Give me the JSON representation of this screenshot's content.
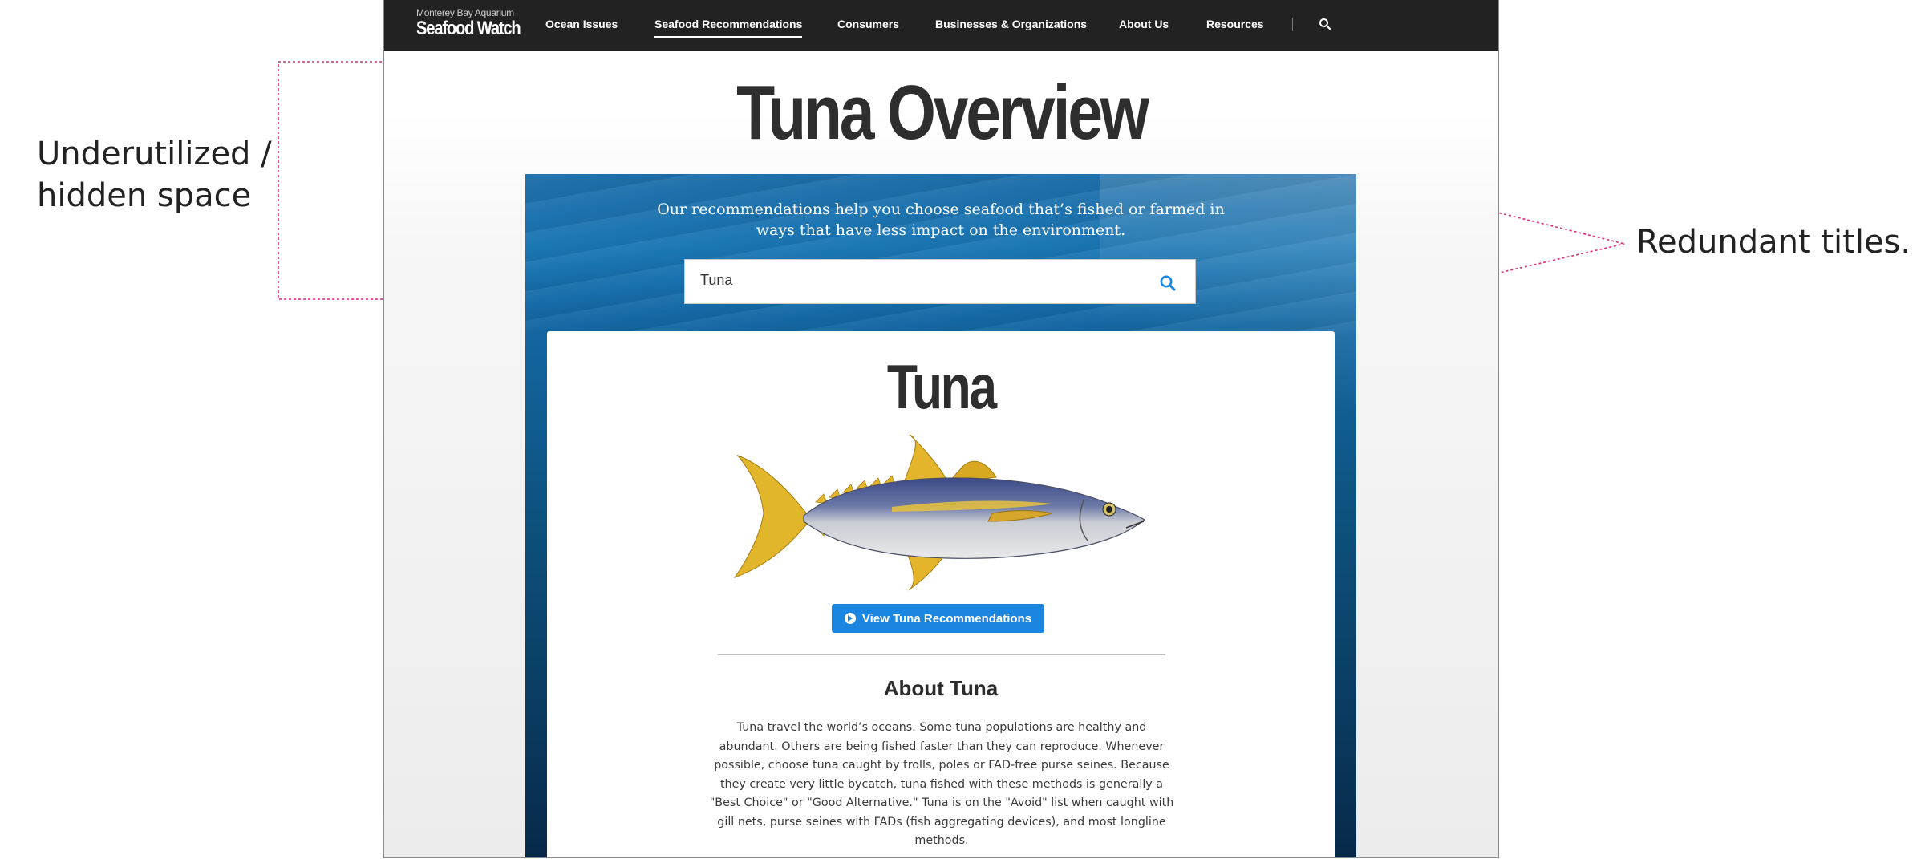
{
  "annotations": {
    "left_label": "Underutilized / hidden space",
    "right_label": "Redundant titles.",
    "line_color": "#e0287d"
  },
  "brand": {
    "small": "Monterey Bay Aquarium",
    "name": "Seafood Watch"
  },
  "nav": {
    "items": [
      {
        "label": "Ocean Issues",
        "active": false
      },
      {
        "label": "Seafood Recommendations",
        "active": true
      },
      {
        "label": "Consumers",
        "active": false
      },
      {
        "label": "Businesses & Organizations",
        "active": false
      },
      {
        "label": "About Us",
        "active": false
      },
      {
        "label": "Resources",
        "active": false
      }
    ],
    "search_icon": "search-icon"
  },
  "page": {
    "title": "Tuna Overview"
  },
  "hero": {
    "tagline": "Our recommendations help you choose seafood that’s fished or farmed in ways that have less impact on the environment.",
    "search": {
      "value": "Tuna",
      "icon": "search-icon"
    }
  },
  "card": {
    "title": "Tuna",
    "image_icon": "tuna-fish-illustration",
    "button_label": "View Tuna Recommendations",
    "about_heading": "About Tuna",
    "about_body": "Tuna travel the world’s oceans. Some tuna populations are healthy and abundant. Others are being fished faster than they can reproduce. Whenever possible, choose tuna caught by trolls, poles or FAD-free purse seines. Because they create very little bycatch, tuna fished with these methods is generally a \"Best Choice\" or \"Good Alternative.\" Tuna is on the \"Avoid\" list when caught with gill nets, purse seines with FADs (fish aggregating devices), and most longline methods."
  },
  "colors": {
    "navbar": "#222222",
    "button": "#1a86e0",
    "search_icon": "#1a86e0"
  }
}
